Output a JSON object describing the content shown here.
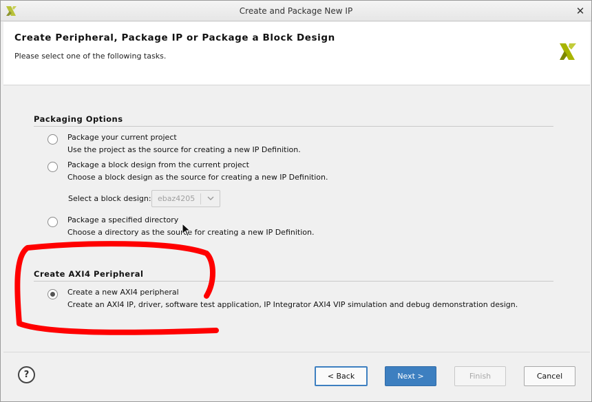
{
  "window": {
    "title": "Create and Package New IP",
    "close_glyph": "✕"
  },
  "header": {
    "title": "Create Peripheral, Package IP or Package a Block Design",
    "subtitle": "Please select one of the following tasks.",
    "logo_icon": "xilinx-logo",
    "accent_color": "#a8b400"
  },
  "packaging": {
    "section_title": "Packaging Options",
    "options": [
      {
        "label": "Package your current project",
        "description": "Use the project as the source for creating a new IP Definition.",
        "selected": false
      },
      {
        "label": "Package a block design from the current project",
        "description": "Choose a block design as the source for creating a new IP Definition.",
        "selected": false
      },
      {
        "label": "Package a specified directory",
        "description": "Choose a directory as the source for creating a new IP Definition.",
        "selected": false
      }
    ],
    "block_design_select": {
      "label": "Select a block design:",
      "value": "ebaz4205"
    }
  },
  "axi4": {
    "section_title": "Create AXI4 Peripheral",
    "option": {
      "label": "Create a new AXI4 peripheral",
      "description": "Create an AXI4 IP, driver, software test application, IP Integrator AXI4 VIP simulation and debug demonstration design.",
      "selected": true
    }
  },
  "footer": {
    "help_label": "?",
    "back_label": "< Back",
    "next_label": "Next >",
    "finish_label": "Finish",
    "cancel_label": "Cancel",
    "primary_color": "#3d7fc0"
  },
  "annotation": {
    "color": "#ff0000"
  }
}
